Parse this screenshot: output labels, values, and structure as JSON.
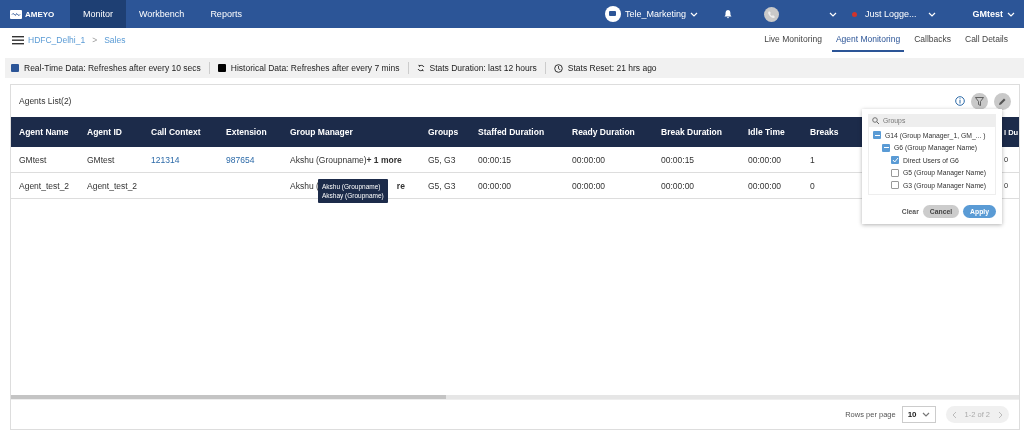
{
  "topbar": {
    "logo": "AMEYO",
    "menu": [
      {
        "label": "Monitor",
        "selected": true
      },
      {
        "label": "Workbench",
        "selected": false
      },
      {
        "label": "Reports",
        "selected": false
      }
    ],
    "campaign": "Tele_Marketing",
    "status": {
      "label": "Just Logge...",
      "color": "#d0342c"
    },
    "user": "GMtest"
  },
  "breadcrumb": {
    "items": [
      "HDFC_Delhi_1",
      "Sales"
    ],
    "separator": ">"
  },
  "tabs": [
    {
      "label": "Live Monitoring",
      "selected": false
    },
    {
      "label": "Agent Monitoring",
      "selected": true
    },
    {
      "label": "Callbacks",
      "selected": false
    },
    {
      "label": "Call Details",
      "selected": false
    }
  ],
  "stats": [
    {
      "kind": "realtime",
      "text": "Real-Time Data: Refreshes after every 10 secs"
    },
    {
      "kind": "historical",
      "text": "Historical Data: Refreshes after every 7 mins"
    },
    {
      "kind": "duration",
      "text": "Stats Duration: last 12 hours"
    },
    {
      "kind": "reset",
      "text": "Stats Reset: 21 hrs ago"
    }
  ],
  "card": {
    "title": "Agents List(2)"
  },
  "table": {
    "columns": [
      "Agent Name",
      "Agent ID",
      "Call Context",
      "Extension",
      "Group Manager",
      "Groups",
      "Staffed Duration",
      "Ready Duration",
      "Break Duration",
      "Idle Time",
      "Breaks",
      "",
      "l Du"
    ],
    "rows": [
      {
        "cells": [
          {
            "kind": "plain",
            "text": "GMtest"
          },
          {
            "kind": "plain",
            "text": "GMtest"
          },
          {
            "kind": "link",
            "text": "121314"
          },
          {
            "kind": "link",
            "text": "987654"
          },
          {
            "kind": "group",
            "text": "Akshu (Groupname)",
            "more": "+ 1 more"
          },
          {
            "kind": "plain",
            "text": "G5, G3"
          },
          {
            "kind": "plain",
            "text": "00:00:15"
          },
          {
            "kind": "plain",
            "text": "00:00:00"
          },
          {
            "kind": "plain",
            "text": "00:00:15"
          },
          {
            "kind": "plain",
            "text": "00:00:00"
          },
          {
            "kind": "plain",
            "text": "1"
          },
          {
            "kind": "empty"
          },
          {
            "kind": "plain",
            "text": "0"
          }
        ]
      },
      {
        "cells": [
          {
            "kind": "plain",
            "text": "Agent_test_2"
          },
          {
            "kind": "plain",
            "text": "Agent_test_2"
          },
          {
            "kind": "empty"
          },
          {
            "kind": "empty"
          },
          {
            "kind": "covered",
            "before": "Akshu (",
            "after": "re"
          },
          {
            "kind": "plain",
            "text": "G5, G3"
          },
          {
            "kind": "plain",
            "text": "00:00:00"
          },
          {
            "kind": "plain",
            "text": "00:00:00"
          },
          {
            "kind": "plain",
            "text": "00:00:00"
          },
          {
            "kind": "plain",
            "text": "00:00:00"
          },
          {
            "kind": "plain",
            "text": "0"
          },
          {
            "kind": "empty"
          },
          {
            "kind": "plain",
            "text": "0"
          }
        ]
      }
    ]
  },
  "tooltip": {
    "lines": [
      "Akshu (Groupname)",
      "Akshay (Groupname)"
    ]
  },
  "filter_popup": {
    "placeholder": "Groups",
    "tree": [
      {
        "label": "G14 (Group Manager_1, GM_... )",
        "partial": true,
        "children": [
          {
            "label": "G6 (Group Manager Name)",
            "partial": true,
            "children": [
              {
                "label": "Direct Users of G6",
                "checked": true
              },
              {
                "label": "G5 (Group Manager Name)",
                "checked": false
              },
              {
                "label": "G3 (Group Manager Name)",
                "checked": false
              }
            ]
          }
        ]
      }
    ],
    "buttons": [
      {
        "label": "Clear",
        "kind": "text"
      },
      {
        "label": "Cancel",
        "kind": "secondary"
      },
      {
        "label": "Apply",
        "kind": "primary"
      }
    ]
  },
  "footer": {
    "rows_per_page_label": "Rows per page",
    "rows_per_page": "10",
    "range": "1-2 of 2"
  }
}
